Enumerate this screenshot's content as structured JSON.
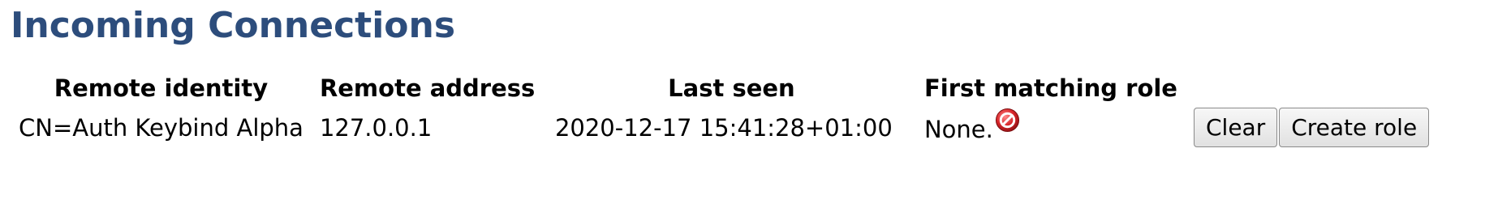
{
  "page": {
    "title": "Incoming Connections"
  },
  "table": {
    "headers": {
      "remote_identity": "Remote identity",
      "remote_address": "Remote address",
      "last_seen": "Last seen",
      "first_matching_role": "First matching role"
    },
    "rows": [
      {
        "remote_identity": "CN=Auth Keybind Alpha",
        "remote_address": "127.0.0.1",
        "last_seen": "2020-12-17 15:41:28+01:00",
        "first_matching_role": "None.",
        "role_icon": "no-entry-icon",
        "clear_label": "Clear",
        "create_role_label": "Create role"
      }
    ]
  },
  "colors": {
    "title": "#2d4d7c",
    "icon_red": "#d8262a"
  }
}
